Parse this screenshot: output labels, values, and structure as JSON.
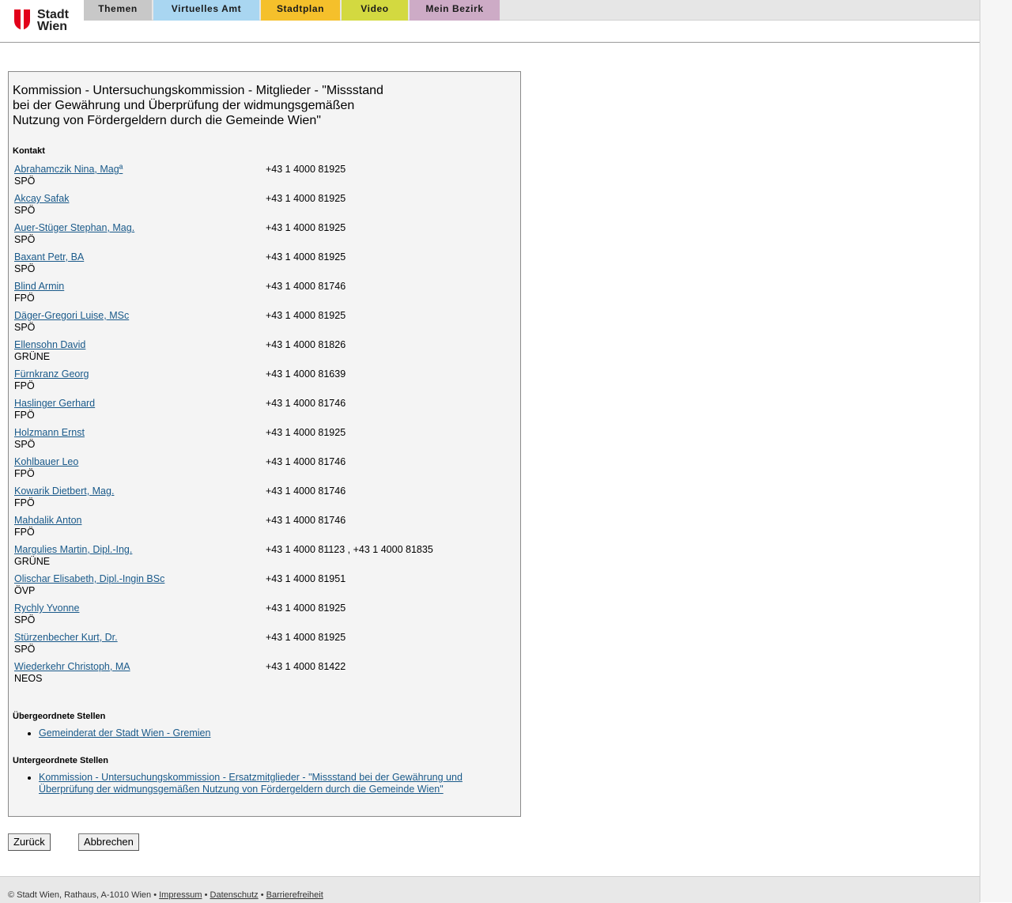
{
  "header": {
    "logo_line1": "Stadt",
    "logo_line2": "Wien",
    "tabs": [
      {
        "label": "Themen",
        "color": "#c8c8c8"
      },
      {
        "label": "Virtuelles Amt",
        "color": "#a9d6f1"
      },
      {
        "label": "Stadtplan",
        "color": "#f5c02b"
      },
      {
        "label": "Video",
        "color": "#d3d940"
      },
      {
        "label": "Mein Bezirk",
        "color": "#cdabc6"
      }
    ],
    "logo_color": "#e2001a"
  },
  "main": {
    "title": "Kommission - Untersuchungskommission - Mitglieder - \"Missstand bei der Gewährung und Überprüfung der widmungsgemäßen Nutzung von Fördergeldern durch die Gemeinde Wien\"",
    "contact_heading": "Kontakt",
    "members": [
      {
        "name": "Abrahamczik Nina, Magª",
        "party": "SPÖ",
        "phone": "+43 1 4000 81925"
      },
      {
        "name": "Akcay Safak",
        "party": "SPÖ",
        "phone": "+43 1 4000 81925"
      },
      {
        "name": "Auer-Stüger Stephan, Mag.",
        "party": "SPÖ",
        "phone": "+43 1 4000 81925"
      },
      {
        "name": "Baxant Petr, BA",
        "party": "SPÖ",
        "phone": "+43 1 4000 81925"
      },
      {
        "name": "Blind Armin",
        "party": "FPÖ",
        "phone": "+43 1 4000 81746"
      },
      {
        "name": "Däger-Gregori Luise, MSc",
        "party": "SPÖ",
        "phone": "+43 1 4000 81925"
      },
      {
        "name": "Ellensohn David",
        "party": "GRÜNE",
        "phone": "+43 1 4000 81826"
      },
      {
        "name": "Fürnkranz Georg",
        "party": "FPÖ",
        "phone": "+43 1 4000 81639"
      },
      {
        "name": "Haslinger Gerhard",
        "party": "FPÖ",
        "phone": "+43 1 4000 81746"
      },
      {
        "name": "Holzmann Ernst",
        "party": "SPÖ",
        "phone": "+43 1 4000 81925"
      },
      {
        "name": "Kohlbauer Leo",
        "party": "FPÖ",
        "phone": "+43 1 4000 81746"
      },
      {
        "name": "Kowarik Dietbert, Mag.",
        "party": "FPÖ",
        "phone": "+43 1 4000 81746"
      },
      {
        "name": "Mahdalik Anton",
        "party": "FPÖ",
        "phone": "+43 1 4000 81746"
      },
      {
        "name": "Margulies Martin, Dipl.-Ing.",
        "party": "GRÜNE",
        "phone": "+43 1 4000 81123 , +43 1 4000 81835"
      },
      {
        "name": "Olischar Elisabeth, Dipl.-Ingin BSc",
        "party": "ÖVP",
        "phone": "+43 1 4000 81951"
      },
      {
        "name": "Rychly Yvonne",
        "party": "SPÖ",
        "phone": "+43 1 4000 81925"
      },
      {
        "name": "Stürzenbecher Kurt, Dr.",
        "party": "SPÖ",
        "phone": "+43 1 4000 81925"
      },
      {
        "name": "Wiederkehr Christoph, MA",
        "party": "NEOS",
        "phone": "+43 1 4000 81422"
      }
    ],
    "parent_heading": "Übergeordnete Stellen",
    "parent_links": [
      "Gemeinderat der Stadt Wien - Gremien"
    ],
    "child_heading": "Untergeordnete Stellen",
    "child_links": [
      "Kommission - Untersuchungskommission - Ersatzmitglieder - \"Missstand bei der Gewährung und Überprüfung der widmungsgemäßen Nutzung von Fördergeldern durch die Gemeinde Wien\""
    ],
    "link_color": "#1a5a8a"
  },
  "buttons": {
    "back_label": "Zurück",
    "cancel_label": "Abbrechen"
  },
  "footer": {
    "copyright": "© Stadt Wien, Rathaus, A-1010 Wien",
    "separator": "•",
    "impressum": "Impressum",
    "datenschutz": "Datenschutz",
    "barrierefreiheit": "Barrierefreiheit"
  }
}
